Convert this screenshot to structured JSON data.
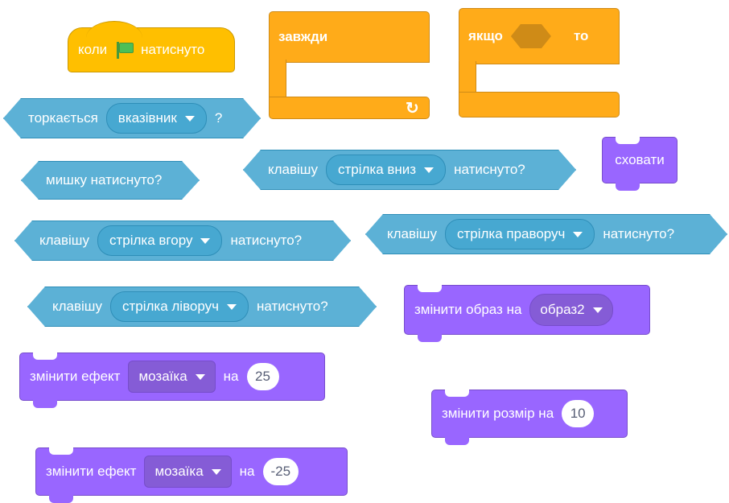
{
  "events": {
    "when_flag_clicked": {
      "pre": "коли",
      "icon": "green-flag-icon",
      "post": "натиснуто"
    }
  },
  "control": {
    "forever": {
      "label": "завжди",
      "icon": "loop-arrow-icon"
    },
    "if_then": {
      "if_label": "якщо",
      "then_label": "то"
    }
  },
  "sensing": {
    "touching": {
      "label": "торкається",
      "dropdown": "вказівник",
      "suffix": "?"
    },
    "mouse_down": {
      "label": "мишку натиснуто?"
    },
    "key_down": {
      "pre": "клавішу",
      "dropdown": "стрілка вниз",
      "post": "натиснуто?"
    },
    "key_up": {
      "pre": "клавішу",
      "dropdown": "стрілка вгору",
      "post": "натиснуто?"
    },
    "key_right": {
      "pre": "клавішу",
      "dropdown": "стрілка праворуч",
      "post": "натиснуто?"
    },
    "key_left": {
      "pre": "клавішу",
      "dropdown": "стрілка ліворуч",
      "post": "натиснуто?"
    }
  },
  "looks": {
    "hide": {
      "label": "сховати"
    },
    "switch_costume": {
      "label": "змінити образ на",
      "dropdown": "образ2"
    },
    "change_effect_1": {
      "label": "змінити ефект",
      "dropdown": "мозаїка",
      "mid": "на",
      "value": "25"
    },
    "change_size": {
      "label": "змінити розмір на",
      "value": "10"
    },
    "change_effect_2": {
      "label": "змінити ефект",
      "dropdown": "мозаїка",
      "mid": "на",
      "value": "-25"
    }
  },
  "colors": {
    "events": "#ffbf00",
    "control": "#ffab19",
    "sensing": "#5cb1d6",
    "looks": "#9966ff"
  }
}
